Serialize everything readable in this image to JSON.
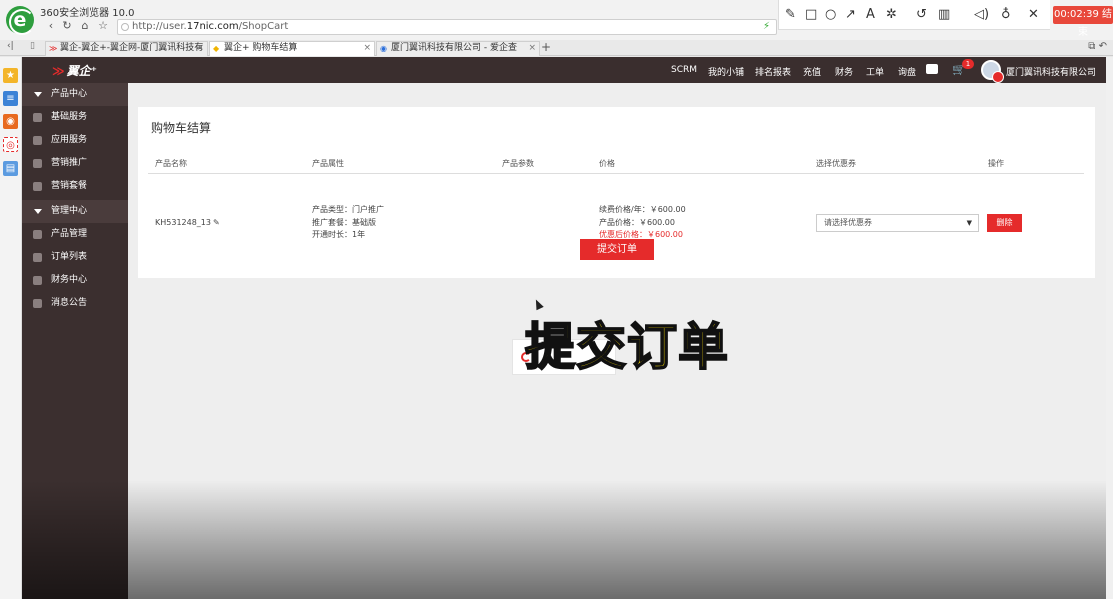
{
  "browser": {
    "title": "360安全浏览器 10.0",
    "logo": "e",
    "url_prefix": "http://user.",
    "url_domain": "17nic.com",
    "url_path": "/ShopCart",
    "tabs": [
      {
        "label": "翼企-翼企+-翼企网-厦门翼讯科技有",
        "active": false
      },
      {
        "label": "翼企+ 购物车结算",
        "active": true
      },
      {
        "label": "厦门翼讯科技有限公司 - 爱企查",
        "active": false
      }
    ],
    "add_tab": "+",
    "recording_timer": "00:02:39 结束",
    "annot_tools": [
      "pen-icon",
      "square-icon",
      "circle-icon",
      "arrow-icon",
      "text-icon",
      "magic-icon",
      "undo-icon",
      "trash-icon",
      "speaker-icon",
      "mic-icon",
      "close-icon"
    ]
  },
  "app": {
    "brand": "翼企⁺",
    "nav": [
      "SCRM",
      "我的小铺",
      "排名报表",
      "充值",
      "财务",
      "工单",
      "询盘"
    ],
    "cart_count": "1",
    "company": "厦门翼讯科技有限公司",
    "sidebar": [
      {
        "type": "group",
        "label": "产品中心"
      },
      {
        "type": "item",
        "label": "基础服务"
      },
      {
        "type": "item",
        "label": "应用服务"
      },
      {
        "type": "item",
        "label": "营销推广"
      },
      {
        "type": "item",
        "label": "营销套餐"
      },
      {
        "type": "group",
        "label": "管理中心"
      },
      {
        "type": "item",
        "label": "产品管理"
      },
      {
        "type": "item",
        "label": "订单列表"
      },
      {
        "type": "item",
        "label": "财务中心"
      },
      {
        "type": "item",
        "label": "消息公告"
      }
    ]
  },
  "cart": {
    "title": "购物车结算",
    "headers": [
      "产品名称",
      "产品属性",
      "产品参数",
      "价格",
      "选择优惠券",
      "操作"
    ],
    "row": {
      "name": "KH531248_13",
      "attr_type": "产品类型：门户推广",
      "attr_package": "推广套餐：基础版",
      "attr_duration": "开通时长：1年",
      "renew_price": "续费价格/年：￥600.00",
      "product_price": "产品价格：￥600.00",
      "discount_price": "优惠后价格：￥600.00",
      "coupon_placeholder": "请选择优惠券",
      "delete_label": "删除"
    },
    "submit_label": "提交订单"
  },
  "overlay": {
    "caption": "提交订单"
  },
  "colors": {
    "accent": "#e52b2b",
    "nav_bg": "#3a2e2e",
    "sidebar_bg": "#3b2f2f",
    "caption": "#ffe100"
  }
}
